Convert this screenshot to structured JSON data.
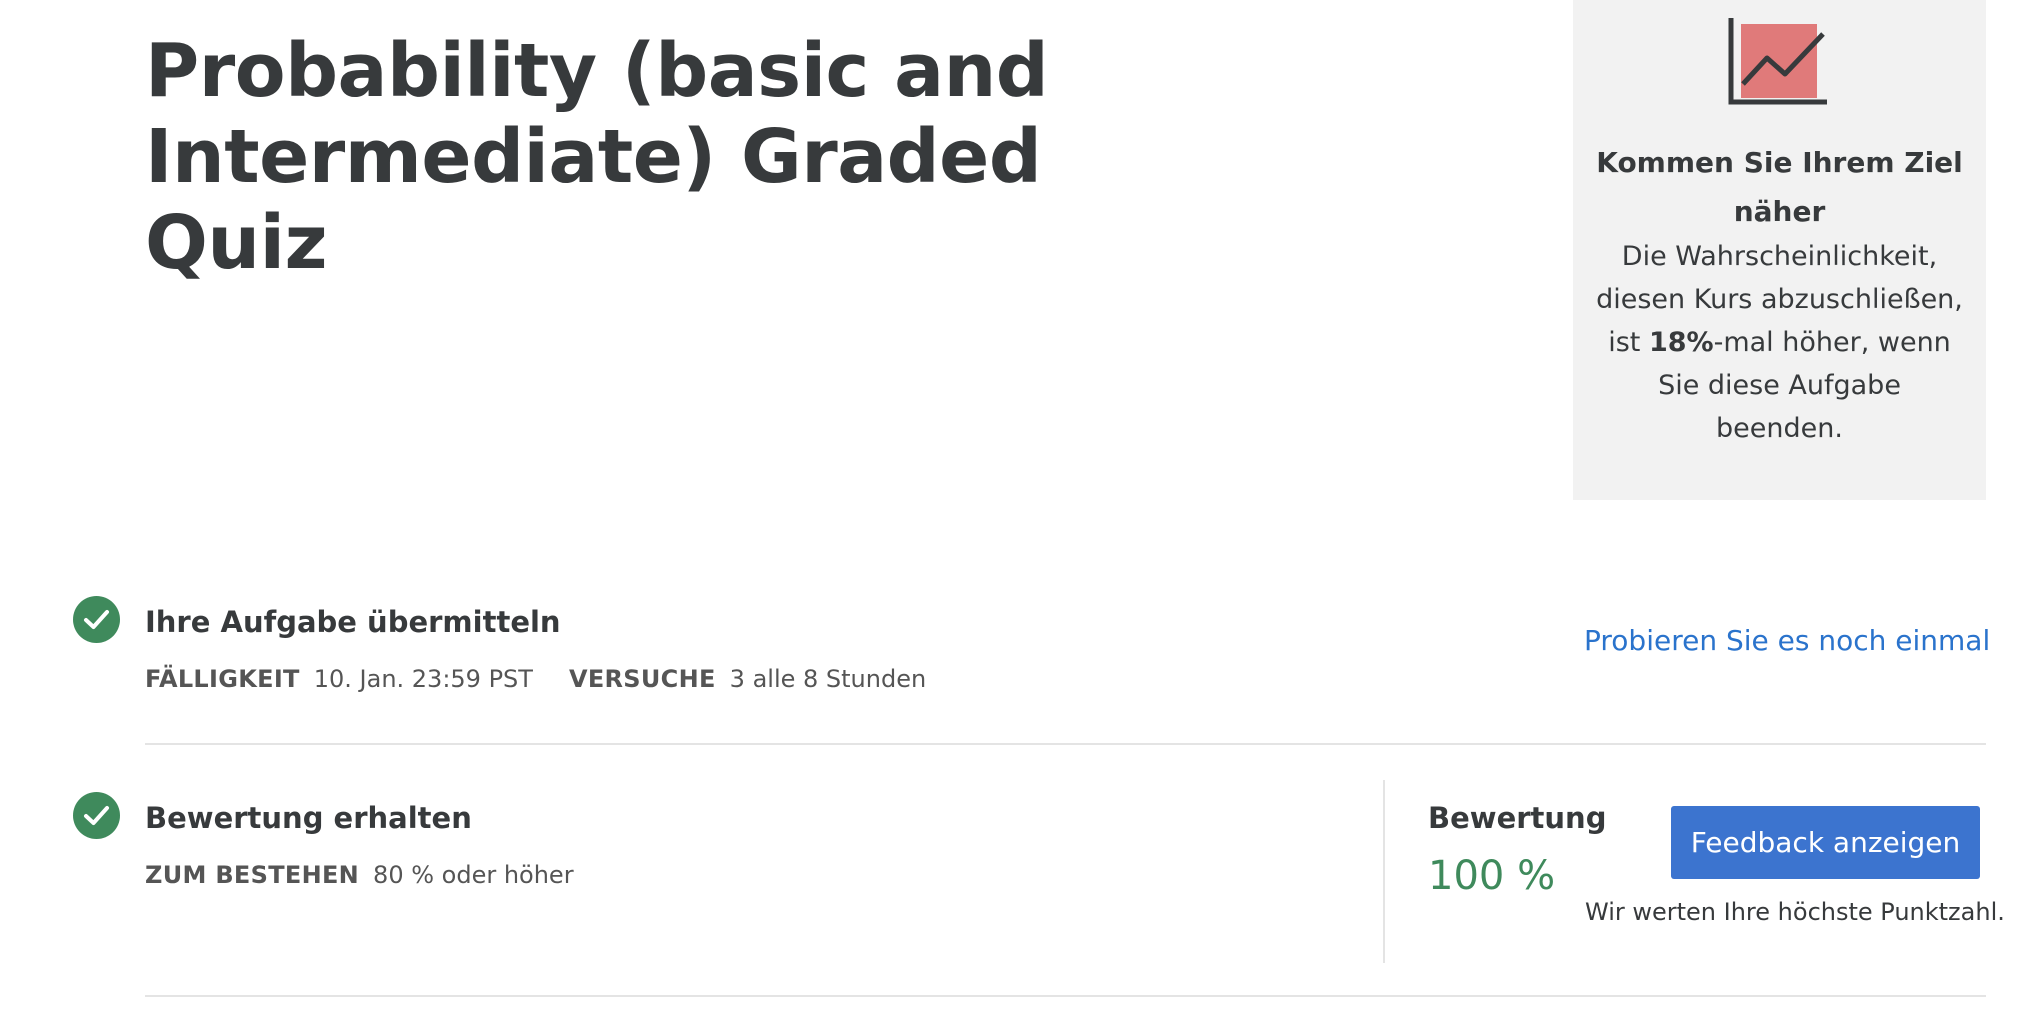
{
  "page": {
    "title": "Probability (basic and Intermediate) Graded Quiz"
  },
  "promo": {
    "icon": "chart-growth-icon",
    "heading": "Kommen Sie Ihrem Ziel näher",
    "text_before": "Die Wahrscheinlichkeit, diesen Kurs abzuschließen, ist ",
    "highlight": "18%",
    "text_after": "-mal höher, wenn Sie diese Aufgabe beenden.",
    "colors": {
      "background": "#f2f2f2",
      "icon_fill": "#e07a7a",
      "icon_stroke": "#373a3c"
    }
  },
  "submit_step": {
    "icon": "check-circle-icon",
    "title": "Ihre Aufgabe übermitteln",
    "due_label": "FÄLLIGKEIT",
    "due_value": "10. Jan. 23:59 PST",
    "attempts_label": "VERSUCHE",
    "attempts_value": "3 alle 8 Stunden",
    "retry_link": "Probieren Sie es noch einmal"
  },
  "grade_step": {
    "icon": "check-circle-icon",
    "title": "Bewertung erhalten",
    "pass_label": "ZUM BESTEHEN",
    "pass_value": "80 % oder höher",
    "grade_label": "Bewertung",
    "grade_value": "100 %",
    "feedback_button": "Feedback anzeigen",
    "note": "Wir werten Ihre höchste Punktzahl."
  },
  "colors": {
    "success_green": "#3f8a5c",
    "link_blue": "#2a73cc",
    "button_blue": "#3c74cf",
    "text_dark": "#373a3c"
  }
}
